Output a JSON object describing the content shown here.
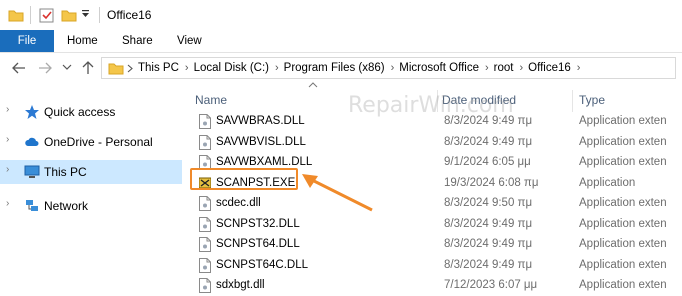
{
  "window": {
    "title": "Office16"
  },
  "ribbon": {
    "file": "File",
    "tabs": [
      "Home",
      "Share",
      "View"
    ]
  },
  "address": {
    "crumbs": [
      "This PC",
      "Local Disk (C:)",
      "Program Files (x86)",
      "Microsoft Office",
      "root",
      "Office16"
    ]
  },
  "nav": {
    "items": [
      {
        "label": "Quick access",
        "icon": "star-icon"
      },
      {
        "label": "OneDrive - Personal",
        "icon": "cloud-icon"
      },
      {
        "label": "This PC",
        "icon": "computer-icon"
      },
      {
        "label": "Network",
        "icon": "network-icon"
      }
    ]
  },
  "columns": {
    "name": "Name",
    "date": "Date modified",
    "type": "Type"
  },
  "files": [
    {
      "name": "SAVWBRAS.DLL",
      "date": "8/3/2024 9:49 πμ",
      "type": "Application exten"
    },
    {
      "name": "SAVWBVISL.DLL",
      "date": "8/3/2024 9:49 πμ",
      "type": "Application exten"
    },
    {
      "name": "SAVWBXAML.DLL",
      "date": "9/1/2024 6:05 μμ",
      "type": "Application exten"
    },
    {
      "name": "SCANPST.EXE",
      "date": "19/3/2024 6:08 πμ",
      "type": "Application"
    },
    {
      "name": "scdec.dll",
      "date": "8/3/2024 9:50 πμ",
      "type": "Application exten"
    },
    {
      "name": "SCNPST32.DLL",
      "date": "8/3/2024 9:49 πμ",
      "type": "Application exten"
    },
    {
      "name": "SCNPST64.DLL",
      "date": "8/3/2024 9:49 πμ",
      "type": "Application exten"
    },
    {
      "name": "SCNPST64C.DLL",
      "date": "8/3/2024 9:49 πμ",
      "type": "Application exten"
    },
    {
      "name": "sdxbgt.dll",
      "date": "7/12/2023 6:07 μμ",
      "type": "Application exten"
    }
  ],
  "watermark": "RepairWin.com",
  "colors": {
    "accent": "#1a6dbc",
    "selected": "#cce8ff",
    "annotation": "#f08a2a"
  }
}
